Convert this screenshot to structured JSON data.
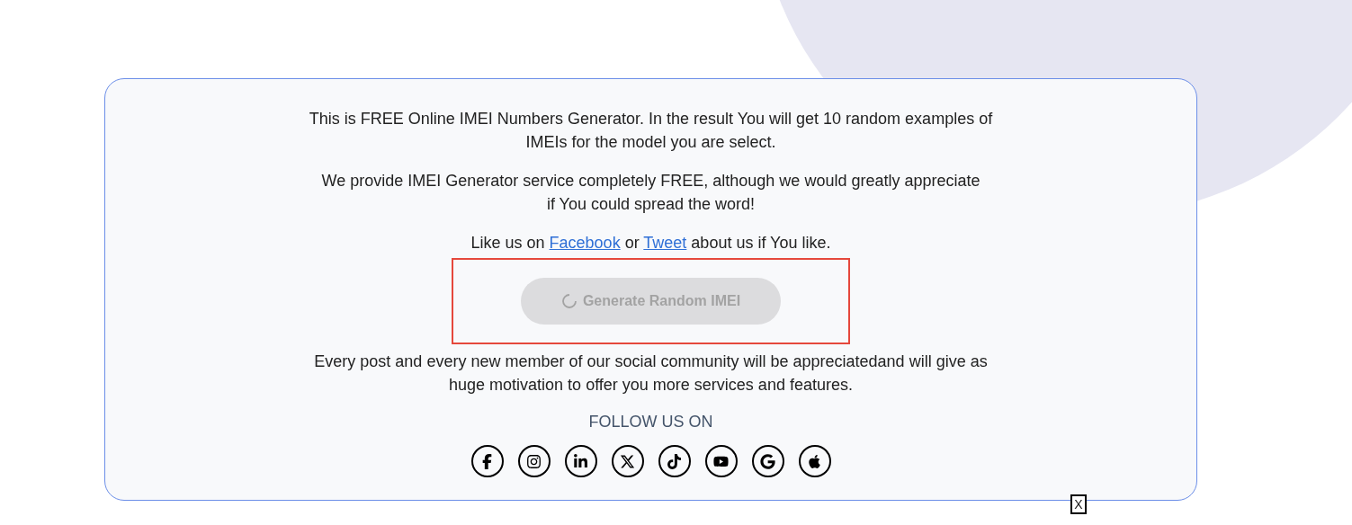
{
  "intro": "This is FREE Online IMEI Numbers Generator. In the result You will get 10 random examples of IMEIs for the model you are select.",
  "service_note": "We provide IMEI Generator service completely FREE, although we would greatly appreciate if You could spread the word!",
  "like_line": [
    {
      "kind": "text",
      "text": "Like us on "
    },
    {
      "kind": "link",
      "text": "Facebook"
    },
    {
      "kind": "text",
      "text": " or "
    },
    {
      "kind": "link",
      "text": "Tweet"
    },
    {
      "kind": "text",
      "text": " about us if You like."
    }
  ],
  "generate_button": {
    "label": "Generate Random IMEI",
    "disabled": true,
    "loading": true,
    "highlighted": true
  },
  "community_note": "Every post and every new member of our social community will be appreciatedand will give as huge motivation to offer you more services and features.",
  "follow_heading": "FOLLOW US ON",
  "close_button": {
    "label": "X"
  }
}
